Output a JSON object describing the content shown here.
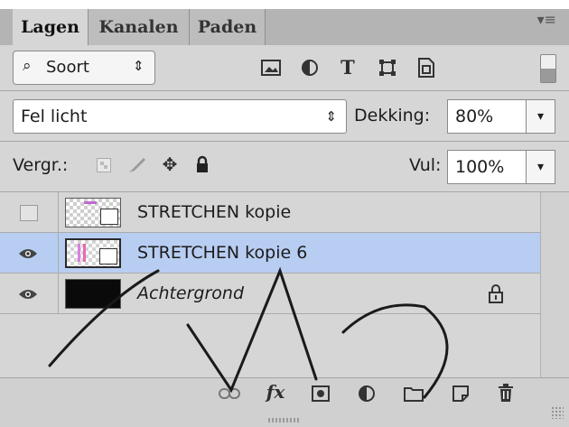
{
  "tabs": [
    {
      "label": "Lagen",
      "active": true
    },
    {
      "label": "Kanalen",
      "active": false
    },
    {
      "label": "Paden",
      "active": false
    }
  ],
  "filter": {
    "label": "Soort",
    "icons": [
      "image-filter-icon",
      "adjustment-filter-icon",
      "type-filter-icon",
      "shape-filter-icon",
      "smart-object-filter-icon"
    ]
  },
  "blend": {
    "mode": "Fel licht",
    "opacity_label": "Dekking:",
    "opacity_value": "80%"
  },
  "lock": {
    "label": "Vergr.:",
    "fill_label": "Vul:",
    "fill_value": "100%"
  },
  "layers": [
    {
      "name": "STRETCHEN kopie",
      "visible": false,
      "selected": false,
      "italic": false,
      "locked": false
    },
    {
      "name": "STRETCHEN kopie 6",
      "visible": true,
      "selected": true,
      "italic": false,
      "locked": false
    },
    {
      "name": "Achtergrond",
      "visible": true,
      "selected": false,
      "italic": true,
      "locked": true
    }
  ],
  "colors": {
    "selection": "#b8cdf2",
    "panel": "#d6d6d6",
    "tab_bar": "#b4b4b4"
  }
}
